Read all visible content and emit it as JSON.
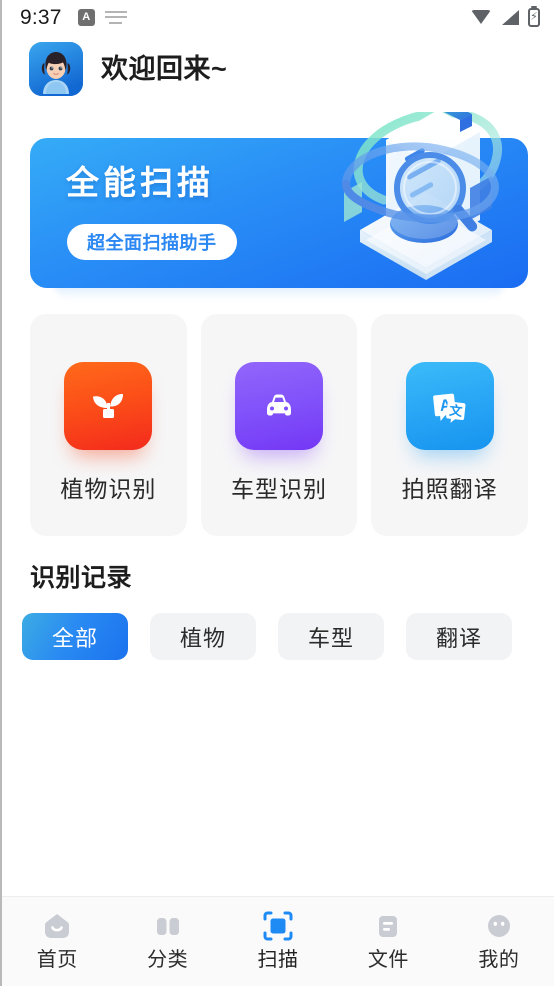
{
  "status_bar": {
    "time": "9:37",
    "badge_label": "A",
    "icons": [
      "keyboard-icon",
      "wifi-icon",
      "signal-icon",
      "battery-charging-icon"
    ]
  },
  "header": {
    "avatar_alt": "user-avatar",
    "welcome_text": "欢迎回来~"
  },
  "banner": {
    "title": "全能扫描",
    "pill_label": "超全面扫描助手",
    "illustration": "scanner-document-magnifier-illustration",
    "gradient_from": "#35acf7",
    "gradient_to": "#1a6cf2",
    "pill_text_color": "#2b87f2"
  },
  "features": [
    {
      "label": "植物识别",
      "icon": "sprout-icon",
      "color_from": "#ff6a1b",
      "color_to": "#f32a1d"
    },
    {
      "label": "车型识别",
      "icon": "car-icon",
      "color_from": "#9266fb",
      "color_to": "#7437f5"
    },
    {
      "label": "拍照翻译",
      "icon": "translate-icon",
      "color_from": "#3cbbf9",
      "color_to": "#1694ef"
    }
  ],
  "records": {
    "section_title": "识别记录",
    "filters": [
      {
        "label": "全部",
        "active": true
      },
      {
        "label": "植物",
        "active": false
      },
      {
        "label": "车型",
        "active": false
      },
      {
        "label": "翻译",
        "active": false
      }
    ],
    "active_filter_color": "#2a8bf2",
    "empty": true
  },
  "bottom_nav": {
    "items": [
      {
        "label": "首页",
        "icon": "home-icon",
        "active": false
      },
      {
        "label": "分类",
        "icon": "category-book-icon",
        "active": false
      },
      {
        "label": "扫描",
        "icon": "scan-frame-icon",
        "active": true
      },
      {
        "label": "文件",
        "icon": "file-icon",
        "active": false
      },
      {
        "label": "我的",
        "icon": "profile-icon",
        "active": false
      }
    ],
    "active_color": "#1e8bf5",
    "inactive_color": "#c9ccd2"
  }
}
